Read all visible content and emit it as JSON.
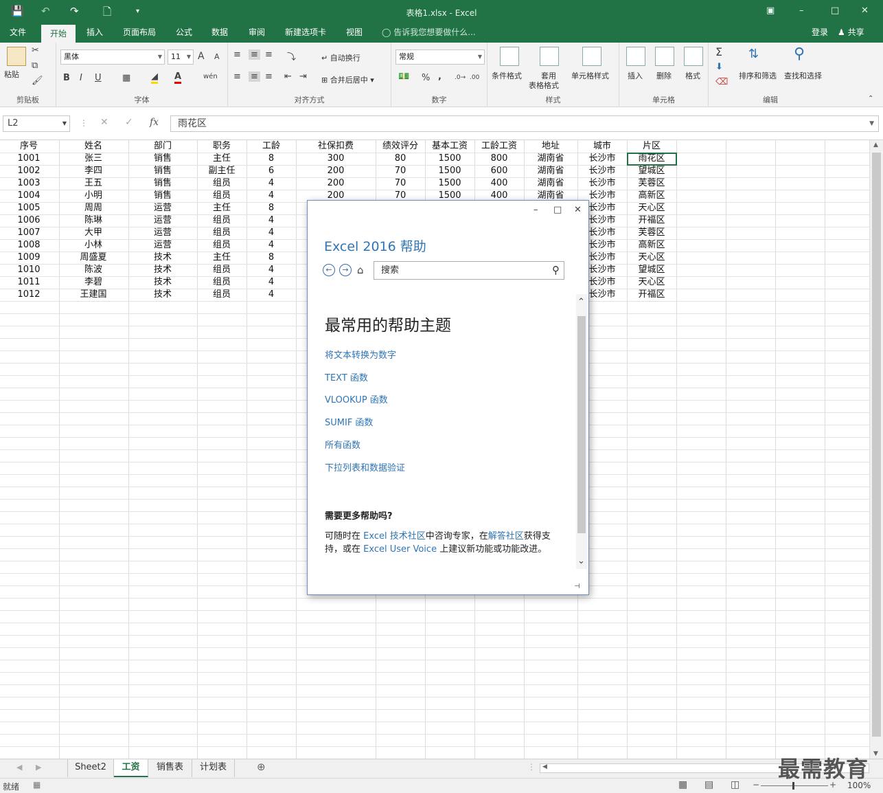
{
  "window": {
    "title": "表格1.xlsx - Excel"
  },
  "ribbon_tabs": [
    "文件",
    "开始",
    "插入",
    "页面布局",
    "公式",
    "数据",
    "审阅",
    "新建选项卡",
    "视图"
  ],
  "active_tab": "开始",
  "tell_me": "告诉我您想要做什么...",
  "account": {
    "login": "登录",
    "share": "共享"
  },
  "ribbon": {
    "clipboard": {
      "paste": "粘贴",
      "label": "剪贴板"
    },
    "font": {
      "name": "黑体",
      "size": "11",
      "grow": "A",
      "shrink": "A",
      "bold": "B",
      "italic": "I",
      "underline": "U",
      "label": "字体"
    },
    "align": {
      "wrap": "自动换行",
      "merge": "合并后居中",
      "label": "对齐方式"
    },
    "number": {
      "format": "常规",
      "percent": "%",
      "comma": ",",
      "label": "数字"
    },
    "styles": {
      "conditional": "条件格式",
      "table_line1": "套用",
      "table_line2": "表格格式",
      "cell_styles": "单元格样式",
      "label": "样式"
    },
    "cells": {
      "insert": "插入",
      "delete": "删除",
      "format": "格式",
      "label": "单元格"
    },
    "editing": {
      "sort": "排序和筛选",
      "find": "查找和选择",
      "sum": "Σ",
      "label": "编辑"
    }
  },
  "formula_bar": {
    "name_box": "L2",
    "fx": "fx",
    "content": "雨花区"
  },
  "sheet": {
    "headers": [
      "序号",
      "姓名",
      "部门",
      "职务",
      "工龄",
      "社保扣费",
      "绩效评分",
      "基本工资",
      "工龄工资",
      "地址",
      "城市",
      "片区"
    ],
    "rows": [
      [
        "1001",
        "张三",
        "销售",
        "主任",
        "8",
        "300",
        "80",
        "1500",
        "800",
        "湖南省",
        "长沙市",
        "雨花区"
      ],
      [
        "1002",
        "李四",
        "销售",
        "副主任",
        "6",
        "200",
        "70",
        "1500",
        "600",
        "湖南省",
        "长沙市",
        "望城区"
      ],
      [
        "1003",
        "王五",
        "销售",
        "组员",
        "4",
        "200",
        "70",
        "1500",
        "400",
        "湖南省",
        "长沙市",
        "芙蓉区"
      ],
      [
        "1004",
        "小明",
        "销售",
        "组员",
        "4",
        "200",
        "70",
        "1500",
        "400",
        "湖南省",
        "长沙市",
        "高新区"
      ],
      [
        "1005",
        "周周",
        "运营",
        "主任",
        "8",
        "",
        "",
        "",
        "",
        "",
        "长沙市",
        "天心区"
      ],
      [
        "1006",
        "陈琳",
        "运营",
        "组员",
        "4",
        "",
        "",
        "",
        "",
        "",
        "长沙市",
        "开福区"
      ],
      [
        "1007",
        "大甲",
        "运营",
        "组员",
        "4",
        "",
        "",
        "",
        "",
        "",
        "长沙市",
        "芙蓉区"
      ],
      [
        "1008",
        "小林",
        "运营",
        "组员",
        "4",
        "",
        "",
        "",
        "",
        "",
        "长沙市",
        "高新区"
      ],
      [
        "1009",
        "周盛夏",
        "技术",
        "主任",
        "8",
        "",
        "",
        "",
        "",
        "",
        "长沙市",
        "天心区"
      ],
      [
        "1010",
        "陈波",
        "技术",
        "组员",
        "4",
        "",
        "",
        "",
        "",
        "",
        "长沙市",
        "望城区"
      ],
      [
        "1011",
        "李碧",
        "技术",
        "组员",
        "4",
        "",
        "",
        "",
        "",
        "",
        "长沙市",
        "天心区"
      ],
      [
        "1012",
        "王建国",
        "技术",
        "组员",
        "4",
        "",
        "",
        "",
        "",
        "",
        "长沙市",
        "开福区"
      ]
    ]
  },
  "sheet_tabs": [
    "Sheet2",
    "工资",
    "销售表",
    "计划表"
  ],
  "active_sheet": "工资",
  "status": {
    "ready": "就绪",
    "zoom": "100%"
  },
  "help": {
    "title": "Excel 2016 帮助",
    "search_placeholder": "搜索",
    "heading": "最常用的帮助主题",
    "links": [
      "将文本转换为数字",
      "TEXT 函数",
      "VLOOKUP 函数",
      "SUMIF 函数",
      "所有函数",
      "下拉列表和数据验证"
    ],
    "more_help": "需要更多帮助吗?",
    "para": {
      "t1": "可随时在 ",
      "l1": "Excel 技术社区",
      "t2": "中咨询专家，在",
      "l2": "解答社区",
      "t3": "获得支持，或在 ",
      "l3": "Excel User Voice",
      "t4": " 上建议新功能或功能改进。"
    }
  },
  "watermark": "最需教育"
}
